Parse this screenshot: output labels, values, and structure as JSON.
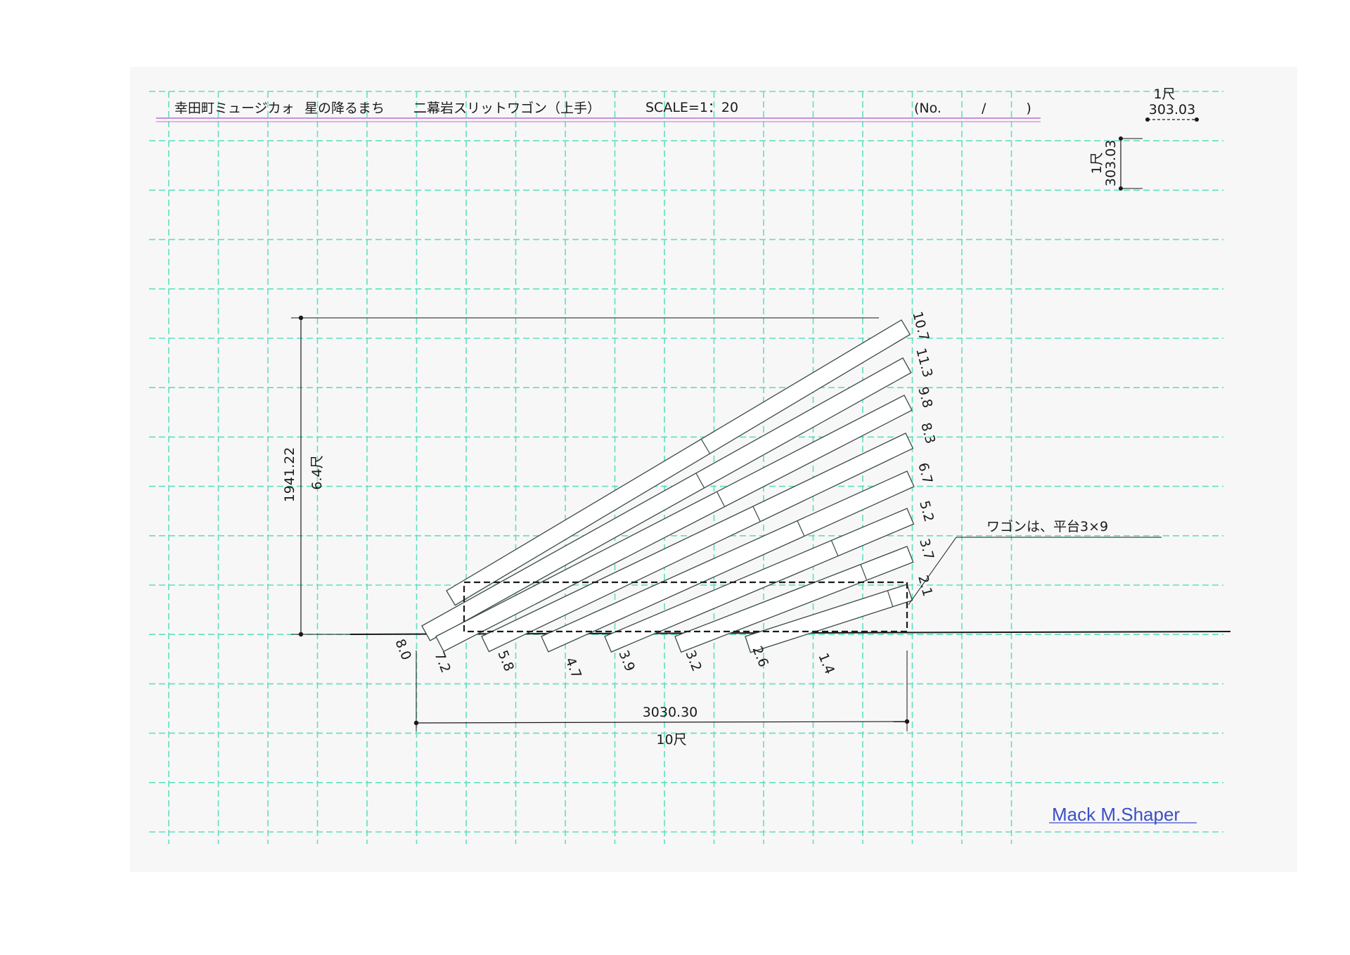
{
  "header": {
    "production": "幸田町ミュージカォ",
    "show": "星の降るまち",
    "piece": "二幕岩スリットワゴン（上手）",
    "scale": "SCALE=1：20",
    "sheet_no": "(No.　　　/　　　)"
  },
  "scale_marks": {
    "horizontal_unit": "1尺",
    "horizontal_value": "303.03",
    "vertical_unit": "1尺",
    "vertical_value": "303.03"
  },
  "dimensions": {
    "height_mm": "1941.22",
    "height_shaku": "6.4尺",
    "width_mm": "3030.30",
    "width_shaku": "10尺"
  },
  "right_labels": [
    "10.7",
    "11.3",
    "9.8",
    "8.3",
    "6.7",
    "5.2",
    "3.7",
    "2.1"
  ],
  "bottom_labels": [
    "8.0",
    "7.2",
    "5.8",
    "4.7",
    "3.9",
    "3.2",
    "2.6",
    "1.4"
  ],
  "note": "ワゴンは、平台3×9",
  "signature": "Mack  M.Shaper",
  "colors": {
    "grid": "#5fe0c0",
    "title_rule": "#c890d8",
    "ink": "#1a1a1a",
    "slat": "#3a4a48",
    "signature": "#3c4fc8"
  }
}
